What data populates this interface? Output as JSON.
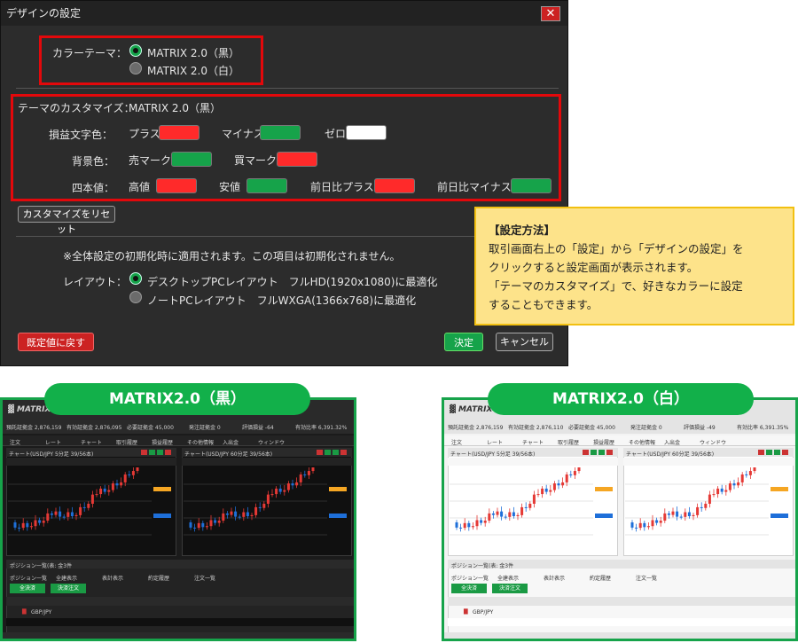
{
  "dialog": {
    "title": "デザインの設定",
    "close_label": "✕",
    "color_theme": {
      "label": "カラーテーマ：",
      "options": [
        "MATRIX 2.0（黒）",
        "MATRIX 2.0（白）"
      ],
      "selected": 0
    },
    "customize": {
      "label": "テーマのカスタマイズ：",
      "current_theme": "MATRIX 2.0（黒）",
      "rows": [
        {
          "label": "損益文字色：",
          "items": [
            {
              "label": "プラス",
              "color": "#ff2a2a"
            },
            {
              "label": "マイナス",
              "color": "#16a34a"
            },
            {
              "label": "ゼロ",
              "color": "#ffffff"
            }
          ]
        },
        {
          "label": "背景色：",
          "items": [
            {
              "label": "売マーク",
              "color": "#16a34a"
            },
            {
              "label": "買マーク",
              "color": "#ff2a2a"
            }
          ]
        },
        {
          "label": "四本値：",
          "items": [
            {
              "label": "高値",
              "color": "#ff2a2a"
            },
            {
              "label": "安値",
              "color": "#16a34a"
            },
            {
              "label": "前日比プラス",
              "color": "#ff2a2a"
            },
            {
              "label": "前日比マイナス",
              "color": "#16a34a"
            }
          ]
        }
      ],
      "reset_button": "カスタマイズをリセット"
    },
    "note": "※全体設定の初期化時に適用されます。この項目は初期化されません。",
    "layout": {
      "label": "レイアウト：",
      "options": [
        "デスクトップPCレイアウト　フルHD(1920x1080)に最適化",
        "ノートPCレイアウト　フルWXGA(1366x768)に最適化"
      ],
      "selected": 0
    },
    "default_button": "既定値に戻す",
    "ok_button": "決定",
    "cancel_button": "キャンセル"
  },
  "info": {
    "heading": "【設定方法】",
    "lines": [
      "取引画面右上の「設定」から「デザインの設定」を",
      "クリックすると設定画面が表示されます。",
      "「テーマのカスタマイズ」で、好きなカラーに設定",
      "することもできます。"
    ]
  },
  "thumbnails": [
    {
      "label": "MATRIX2.0（黒）",
      "theme": "dark",
      "stats": [
        "預託証拠金 2,876,159",
        "有効証拠金 2,876,095",
        "必要証拠金 45,000",
        "発注証拠金 0",
        "評価損益 -64",
        "有効比率 6,391.32%"
      ],
      "menu": [
        "注文",
        "レート",
        "チャート",
        "取引履歴",
        "損益履歴",
        "その他情報",
        "入出金",
        "ウィンドウ"
      ],
      "chart_titles": [
        "チャート(USD/JPY 5分足 39/56本)",
        "チャート(USD/JPY 60分足 39/56本)"
      ],
      "panel_title": "ポジション一覧(表: 金3件",
      "tabs": [
        "ポジション一覧",
        "全建表示",
        "表計表示",
        "約定履歴",
        "注文一覧"
      ],
      "buttons": [
        "全決済",
        "決済注文"
      ],
      "pair": "GBP/JPY"
    },
    {
      "label": "MATRIX2.0（白）",
      "theme": "light",
      "stats": [
        "預託証拠金 2,876,159",
        "有効証拠金 2,876,110",
        "必要証拠金 45,000",
        "発注証拠金 0",
        "評価損益 -49",
        "有効比率 6,391.35%"
      ],
      "menu": [
        "注文",
        "レート",
        "チャート",
        "取引履歴",
        "損益履歴",
        "その他情報",
        "入出金",
        "ウィンドウ"
      ],
      "chart_titles": [
        "チャート(USD/JPY 5分足 39/56本)",
        "チャート(USD/JPY 60分足 39/56本)"
      ],
      "panel_title": "ポジション一覧(表: 金3件",
      "tabs": [
        "ポジション一覧",
        "全建表示",
        "表計表示",
        "約定履歴",
        "注文一覧"
      ],
      "buttons": [
        "全決済",
        "決済注文"
      ],
      "pair": "GBP/JPY"
    }
  ]
}
